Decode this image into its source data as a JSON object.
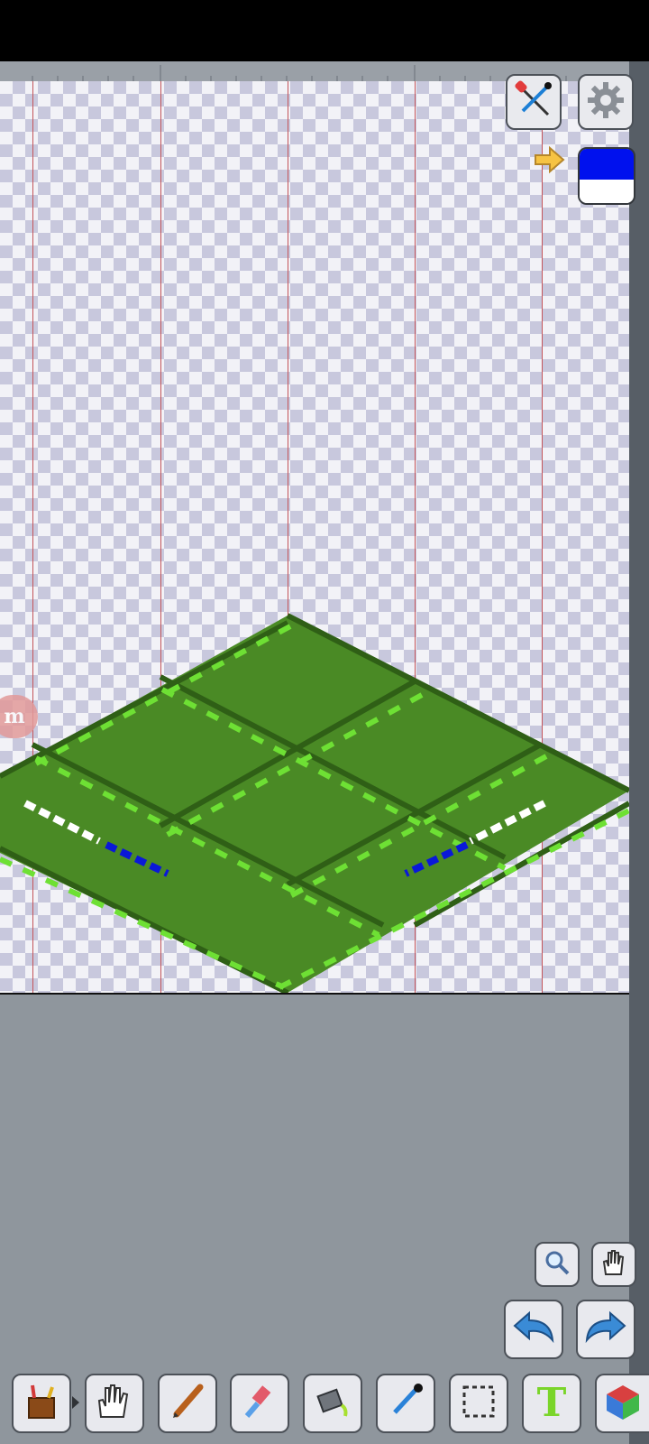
{
  "app": {
    "name": "pixel-editor"
  },
  "canvas": {
    "background": "transparent-checker",
    "guide_color": "#c4555a",
    "tile_colors": {
      "fill": "#4a8a25",
      "dark": "#2f5f16",
      "light": "#6ee034",
      "highlight_white": "#ffffff",
      "highlight_blue": "#0a18d8"
    }
  },
  "top_controls": {
    "tools_icon": "screwdriver-pipette-icon",
    "settings_icon": "gear-icon",
    "swap_icon": "swap-arrow-icon",
    "primary_color": "#0011ee",
    "secondary_color": "#ffffff"
  },
  "layer_chip": {
    "label": "m"
  },
  "view_controls": {
    "zoom_icon": "magnifier-icon",
    "pan_icon": "hand-icon"
  },
  "history": {
    "undo_icon": "undo-arrow-icon",
    "redo_icon": "redo-arrow-icon"
  },
  "toolbar": {
    "tools": [
      "toolbox-icon",
      "hand-glove-icon",
      "pen-icon",
      "eraser-icon",
      "bucket-icon",
      "eyedropper-icon",
      "selection-icon",
      "text-icon",
      "3d-cube-icon"
    ],
    "text_tool_glyph": "T"
  }
}
